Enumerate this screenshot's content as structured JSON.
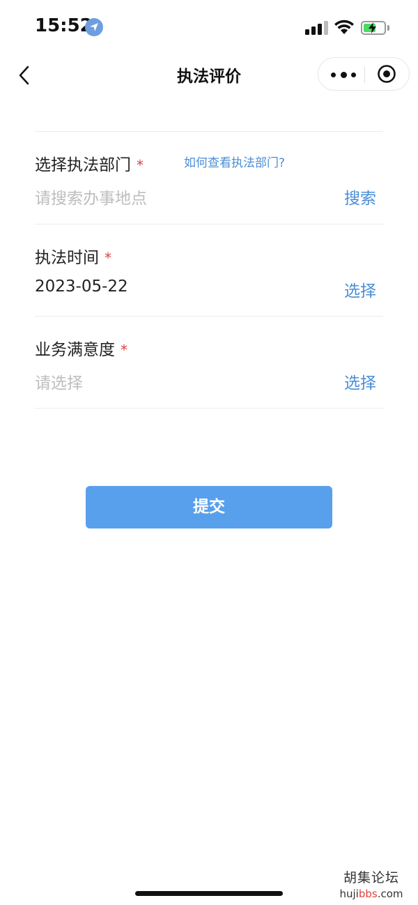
{
  "status_bar": {
    "time": "15:52",
    "battery_level": 0.6,
    "icons": [
      "location-icon",
      "signal-icon",
      "wifi-icon",
      "battery-charging-icon"
    ]
  },
  "nav": {
    "title": "执法评价",
    "icons": [
      "back-icon",
      "more-icon",
      "close-target-icon"
    ]
  },
  "form": {
    "department": {
      "label": "选择执法部门",
      "required_mark": "*",
      "help_link": "如何查看执法部门?",
      "placeholder": "请搜索办事地点",
      "action": "搜索"
    },
    "time": {
      "label": "执法时间",
      "required_mark": "*",
      "value": "2023-05-22",
      "action": "选择"
    },
    "satisfaction": {
      "label": "业务满意度",
      "required_mark": "*",
      "placeholder": "请选择",
      "action": "选择"
    }
  },
  "submit_label": "提交",
  "watermark": {
    "cn": "胡集论坛",
    "url_prefix": "huji",
    "url_highlight": "bbs",
    "url_suffix": ".com"
  },
  "colors": {
    "accent": "#4a8ed6",
    "submit_bg": "#58a0ec",
    "required": "#e04040",
    "placeholder": "#bdbdbd"
  }
}
